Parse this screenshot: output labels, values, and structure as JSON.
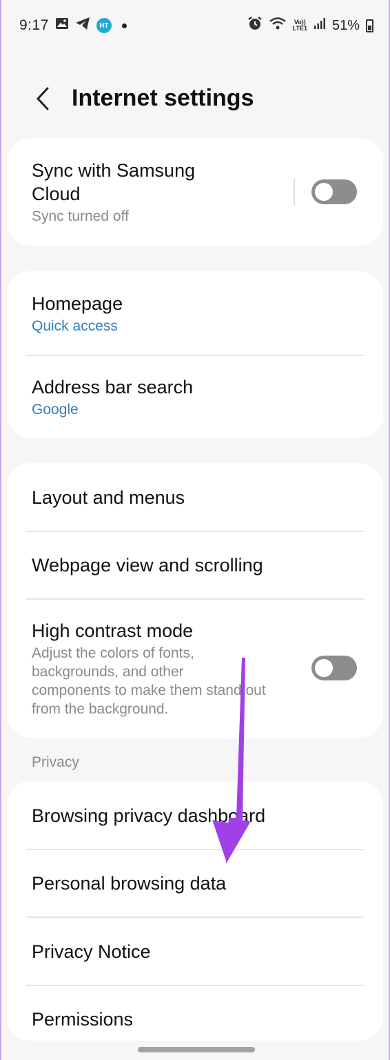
{
  "status_bar": {
    "time": "9:17",
    "badge": "HT",
    "volte_top": "Vo))",
    "volte_bottom": "LTE1",
    "battery": "51%",
    "icons": [
      "image-icon",
      "telegram-icon",
      "ht-badge-icon",
      "alarm-icon",
      "wifi-icon",
      "signal-icon",
      "battery-icon"
    ]
  },
  "header": {
    "title": "Internet settings",
    "back_icon": "chevron-left-icon"
  },
  "card_sync": {
    "title": "Sync with Samsung Cloud",
    "subtitle": "Sync turned off",
    "toggle_on": false
  },
  "card_general": {
    "homepage_title": "Homepage",
    "homepage_value": "Quick access",
    "address_title": "Address bar search",
    "address_value": "Google"
  },
  "card_display": {
    "layout": "Layout and menus",
    "webpage": "Webpage view and scrolling",
    "contrast_title": "High contrast mode",
    "contrast_desc": "Adjust the colors of fonts, backgrounds, and other components to make them stand out from the background.",
    "contrast_toggle_on": false
  },
  "privacy": {
    "section_label": "Privacy",
    "dashboard": "Browsing privacy dashboard",
    "personal": "Personal browsing data",
    "notice": "Privacy Notice",
    "permissions": "Permissions"
  },
  "colors": {
    "accent_blue": "#2f7fbf",
    "annotation_arrow": "#a040e6",
    "toggle_off": "#8d8d8d"
  }
}
